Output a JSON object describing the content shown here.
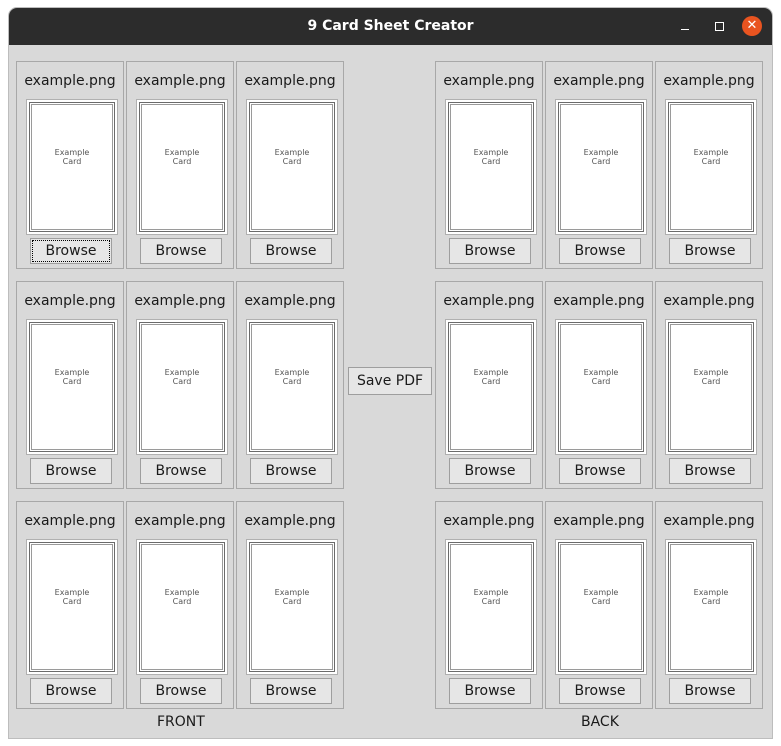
{
  "window": {
    "title": "9 Card Sheet Creator",
    "controls": {
      "minimize": "–",
      "maximize": "□",
      "close": "✕"
    },
    "close_color": "#e95420"
  },
  "card_placeholder_text": "Example\nCard",
  "front": {
    "label": "FRONT",
    "tiles": [
      {
        "filename": "example.png",
        "button": "Browse"
      },
      {
        "filename": "example.png",
        "button": "Browse"
      },
      {
        "filename": "example.png",
        "button": "Browse"
      },
      {
        "filename": "example.png",
        "button": "Browse"
      },
      {
        "filename": "example.png",
        "button": "Browse"
      },
      {
        "filename": "example.png",
        "button": "Browse"
      },
      {
        "filename": "example.png",
        "button": "Browse"
      },
      {
        "filename": "example.png",
        "button": "Browse"
      },
      {
        "filename": "example.png",
        "button": "Browse"
      }
    ]
  },
  "back": {
    "label": "BACK",
    "tiles": [
      {
        "filename": "example.png",
        "button": "Browse"
      },
      {
        "filename": "example.png",
        "button": "Browse"
      },
      {
        "filename": "example.png",
        "button": "Browse"
      },
      {
        "filename": "example.png",
        "button": "Browse"
      },
      {
        "filename": "example.png",
        "button": "Browse"
      },
      {
        "filename": "example.png",
        "button": "Browse"
      },
      {
        "filename": "example.png",
        "button": "Browse"
      },
      {
        "filename": "example.png",
        "button": "Browse"
      },
      {
        "filename": "example.png",
        "button": "Browse"
      }
    ]
  },
  "save_button": "Save PDF"
}
